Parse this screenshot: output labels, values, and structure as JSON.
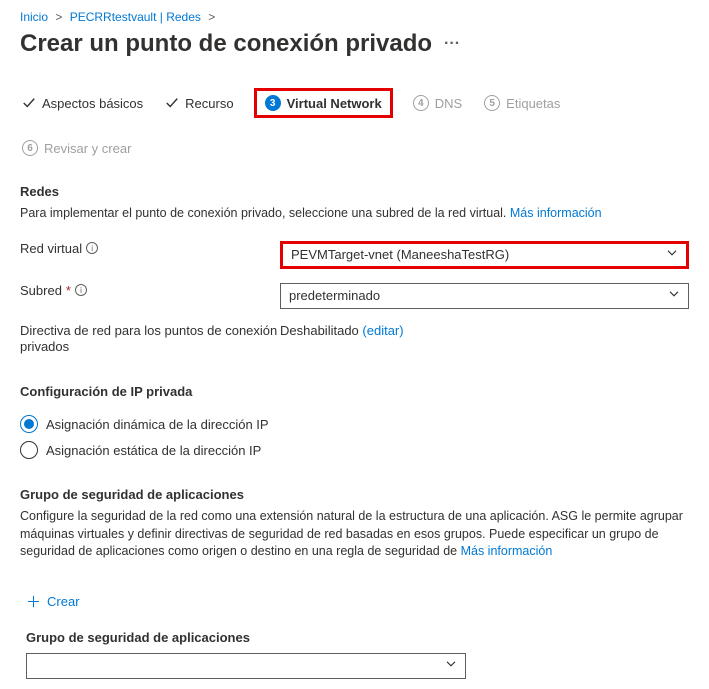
{
  "breadcrumb": {
    "items": [
      "Inicio",
      "PECRRtestvault | Redes"
    ],
    "sep": ">"
  },
  "page": {
    "title": "Crear un punto de conexión privado"
  },
  "tabs": [
    {
      "label": "Aspectos básicos",
      "state": "done"
    },
    {
      "label": "Recurso",
      "state": "done"
    },
    {
      "label": "Virtual Network",
      "num": "3",
      "state": "active"
    },
    {
      "label": "DNS",
      "num": "4",
      "state": "pending"
    },
    {
      "label": "Etiquetas",
      "num": "5",
      "state": "pending"
    },
    {
      "label": "Revisar y crear",
      "num": "6",
      "state": "pending"
    }
  ],
  "redes": {
    "title": "Redes",
    "desc": "Para implementar el punto de conexión privado, seleccione una subred de la red virtual.",
    "more": "Más información",
    "vnet_label": "Red virtual",
    "vnet_value": "PEVMTarget-vnet (ManeeshaTestRG)",
    "subnet_label": "Subred",
    "subnet_value": "predeterminado",
    "policy_label": "Directiva de red para los puntos de conexión privados",
    "policy_value": "Deshabilitado",
    "policy_edit": "(editar)"
  },
  "ipconfig": {
    "title": "Configuración de IP privada",
    "opt_dynamic": "Asignación dinámica de la dirección IP",
    "opt_static": "Asignación estática de la dirección IP"
  },
  "asg": {
    "title": "Grupo de seguridad de aplicaciones",
    "desc": "Configure la seguridad de la red como una extensión natural de la estructura de una aplicación. ASG le permite agrupar máquinas virtuales y definir directivas de seguridad de red basadas en esos grupos. Puede especificar un grupo de seguridad de aplicaciones como origen o destino en una regla de seguridad de",
    "more": "Más información",
    "create": "Crear",
    "sub_label": "Grupo de seguridad de aplicaciones"
  }
}
